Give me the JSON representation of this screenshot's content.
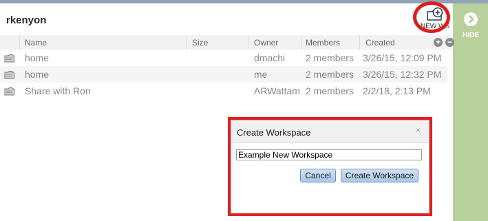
{
  "header": {
    "username": "rkenyon",
    "new_ws_label": "NEW WS"
  },
  "sidebar": {
    "hide_label": "HIDE"
  },
  "table": {
    "columns": [
      "Name",
      "Size",
      "Owner",
      "Members",
      "Created"
    ],
    "rows": [
      {
        "name": "home",
        "size": "",
        "owner": "dmachi",
        "members": "2 members",
        "created": "3/26/15, 12:09 PM"
      },
      {
        "name": "home",
        "size": "",
        "owner": "me",
        "members": "2 members",
        "created": "3/26/15, 12:32 PM"
      },
      {
        "name": "Share with Ron",
        "size": "",
        "owner": "ARWattam",
        "members": "2 members",
        "created": "2/2/18, 2:13 PM"
      }
    ]
  },
  "dialog": {
    "title": "Create Workspace",
    "close": "×",
    "input_value": "Example New Workspace",
    "cancel_label": "Cancel",
    "create_label": "Create Workspace"
  },
  "colors": {
    "highlight": "#e01b1b",
    "sidebar": "#b8d19a",
    "button": "#a9c8e8"
  }
}
